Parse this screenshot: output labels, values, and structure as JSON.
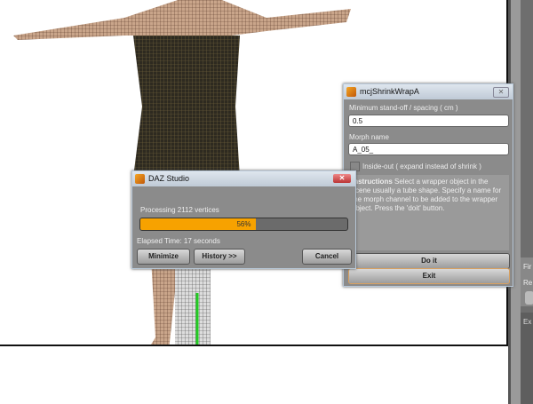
{
  "progress_dialog": {
    "title": "DAZ Studio",
    "status": "Processing 2112 vertices",
    "progress_percent": 56,
    "progress_label": "56%",
    "elapsed": "Elapsed Time:  17 seconds",
    "buttons": {
      "minimize": "Minimize",
      "history": "History >>",
      "cancel": "Cancel"
    },
    "close_icon": "close-icon"
  },
  "shrink_dialog": {
    "title": "mcjShrinkWrapA",
    "spacing_label": "Minimum stand-off / spacing ( cm )",
    "spacing_value": "0.5",
    "morph_label": "Morph name",
    "morph_value": "A_05_",
    "inside_out_label": "Inside-out ( expand instead of shrink )",
    "inside_out_checked": false,
    "instructions_heading": "Instructions",
    "instructions_text": "Select a wrapper object in the scene usually a tube shape. Specify a name for the morph channel to be added to the wrapper object. Press the 'doit' button.",
    "do_it": "Do it",
    "exit": "Exit"
  },
  "side_panel": {
    "label1": "Fir",
    "label2": "Re",
    "label3": "Ex"
  },
  "colors": {
    "progress": "#f7a200",
    "dialog_bg": "#8b8b8b"
  }
}
